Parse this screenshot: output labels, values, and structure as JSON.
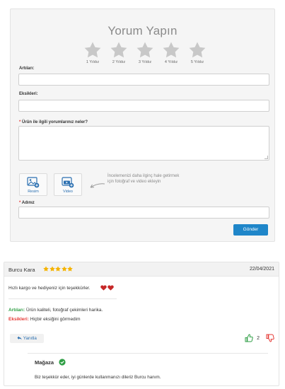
{
  "form": {
    "title": "Yorum Yapın",
    "stars": [
      {
        "label": "1 Yıldız"
      },
      {
        "label": "2 Yıldız"
      },
      {
        "label": "3 Yıldız"
      },
      {
        "label": "4 Yıldız"
      },
      {
        "label": "5 Yıldız"
      }
    ],
    "pros_label": "Artıları:",
    "pros_value": "",
    "cons_label": "Eksikleri:",
    "cons_value": "",
    "comment_required_mark": "*",
    "comment_label": "Ürün ile ilgili yorumlarınız neler?",
    "comment_value": "",
    "media": {
      "photo_label": "Resim",
      "video_label": "Video",
      "photo_icon": "image-icon",
      "video_icon": "youtube-icon"
    },
    "hint_text": "İncelemenizi daha ilginç hale getirmek için fotoğraf ve video ekleyin",
    "name_required_mark": "*",
    "name_label": "Adınız",
    "name_value": "",
    "submit_label": "Gönder",
    "colors": {
      "star_empty": "#c8c8c8",
      "submit_bg": "#1f86c9"
    }
  },
  "review": {
    "author": "Burcu Kara",
    "rating": 5,
    "date": "22/04/2021",
    "text": "Hızlı kargo ve hediyeniz için teşekkürler.",
    "hearts": 2,
    "pros_key": "Artıları:",
    "pros_value": "Ürün kaliteli, fotoğraf çekimleri harika.",
    "cons_key": "Eksikleri:",
    "cons_value": "Hiçbir eksiğini görmedim",
    "reply_label": "Yanıtla",
    "upvotes": "2",
    "colors": {
      "star": "#f5b301",
      "heart": "#c62828",
      "up": "#2e9e44",
      "down": "#e53935"
    }
  },
  "store_reply": {
    "name": "Mağaza",
    "text": "Biz teşekkür eder, iyi günlerde kullanmanızı dileriz Burcu hanım."
  }
}
